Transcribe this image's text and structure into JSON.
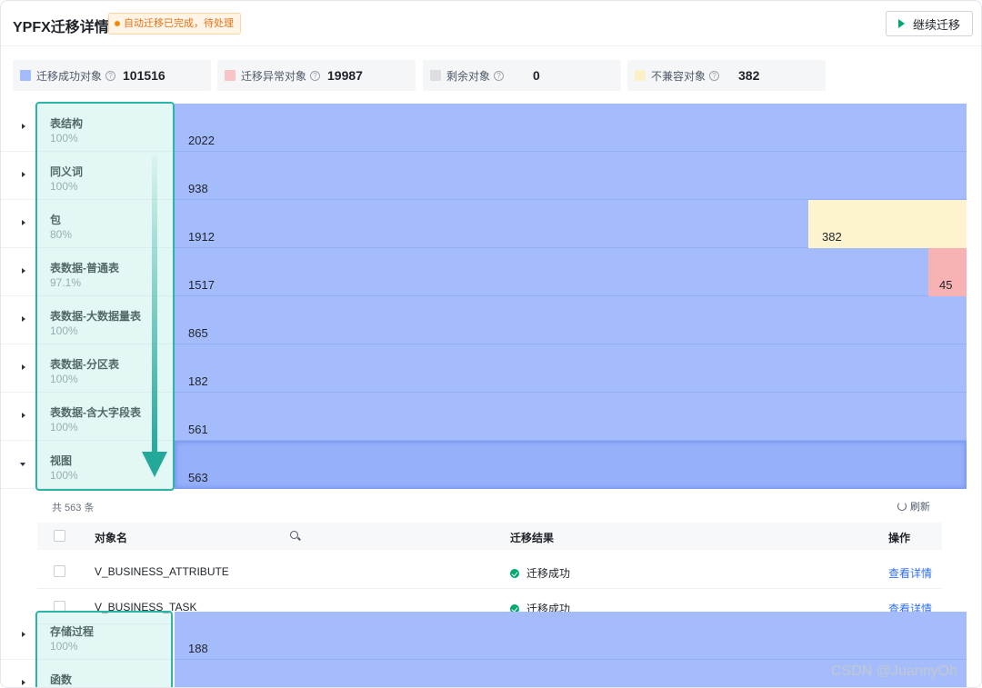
{
  "header": {
    "title": "YPFX迁移详情",
    "status_badge": "自动迁移已完成，待处理",
    "continue_button": "继续迁移"
  },
  "stats": [
    {
      "label": "迁移成功对象",
      "value": "101516",
      "color": "#a4bcfb"
    },
    {
      "label": "迁移异常对象",
      "value": "19987",
      "color": "#f9c4c6"
    },
    {
      "label": "剩余对象",
      "value": "0",
      "color": "#dcdee2"
    },
    {
      "label": "不兼容对象",
      "value": "382",
      "color": "#fdf0c8"
    }
  ],
  "rows": [
    {
      "name": "表结构",
      "pct": "100%",
      "success": "2022"
    },
    {
      "name": "同义词",
      "pct": "100%",
      "success": "938"
    },
    {
      "name": "包",
      "pct": "80%",
      "success": "1912",
      "incompatible": "382"
    },
    {
      "name": "表数据-普通表",
      "pct": "97.1%",
      "success": "1517",
      "failed": "45"
    },
    {
      "name": "表数据-大数据量表",
      "pct": "100%",
      "success": "865"
    },
    {
      "name": "表数据-分区表",
      "pct": "100%",
      "success": "182"
    },
    {
      "name": "表数据-含大字段表",
      "pct": "100%",
      "success": "561"
    },
    {
      "name": "视图",
      "pct": "100%",
      "success": "563"
    }
  ],
  "detail": {
    "count_text": "共 563 条",
    "refresh_label": "刷新",
    "columns": {
      "object": "对象名",
      "result": "迁移结果",
      "action": "操作"
    },
    "items": [
      {
        "object": "V_BUSINESS_ATTRIBUTE",
        "result": "迁移成功",
        "action": "查看详情"
      },
      {
        "object": "V_BUSINESS_TASK",
        "result": "迁移成功",
        "action": "查看详情"
      }
    ]
  },
  "bottom_rows": [
    {
      "name": "存储过程",
      "pct": "100%",
      "success": "188"
    },
    {
      "name": "函数"
    }
  ],
  "watermark": "CSDN @JuannyOh"
}
